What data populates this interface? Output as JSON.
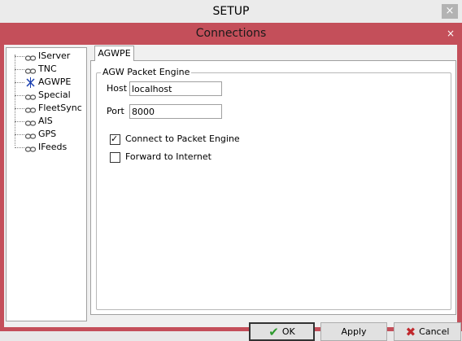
{
  "window": {
    "title": "SETUP",
    "close_glyph": "×"
  },
  "dialog": {
    "title": "Connections",
    "close_glyph": "×"
  },
  "tree": {
    "items": [
      {
        "label": "IServer",
        "icon": "chain-link-icon"
      },
      {
        "label": "TNC",
        "icon": "chain-link-icon"
      },
      {
        "label": "AGWPE",
        "icon": "satellite-icon",
        "selected": true
      },
      {
        "label": "Special",
        "icon": "chain-link-icon"
      },
      {
        "label": "FleetSync",
        "icon": "chain-link-icon"
      },
      {
        "label": "AIS",
        "icon": "chain-link-icon"
      },
      {
        "label": "GPS",
        "icon": "chain-link-icon"
      },
      {
        "label": "IFeeds",
        "icon": "chain-link-icon"
      }
    ]
  },
  "tab": {
    "label": "AGWPE"
  },
  "group": {
    "title": "AGW Packet Engine",
    "host_label": "Host",
    "host_value": "localhost",
    "port_label": "Port",
    "port_value": "8000",
    "connect_label": "Connect to Packet Engine",
    "connect_checked": true,
    "forward_label": "Forward to Internet",
    "forward_checked": false
  },
  "buttons": {
    "ok": "OK",
    "apply": "Apply",
    "cancel": "Cancel"
  },
  "colors": {
    "dialog_frame": "#c44f5a",
    "ok_check": "#2e9a2e",
    "cancel_x": "#c0282d"
  }
}
